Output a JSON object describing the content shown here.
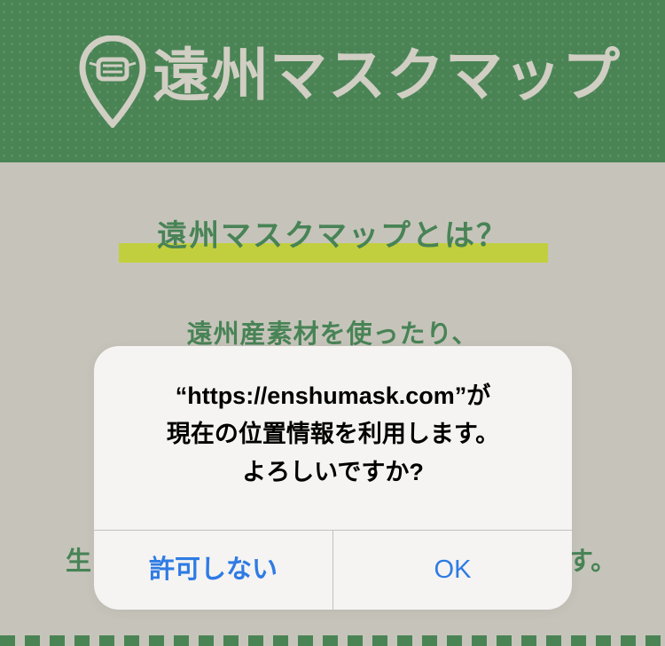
{
  "site": {
    "logo_text": "遠州マスクマップ",
    "logo_icon": "map-pin-mask-icon"
  },
  "about": {
    "title": "遠州マスクマップとは？",
    "line1": "遠州産素材を使ったり、",
    "fragment_left": "生",
    "fragment_right": "す。"
  },
  "alert": {
    "line1": "“https://enshumask.com”が",
    "line2": "現在の位置情報を利用します。",
    "line3": "よろしいですか?",
    "deny_label": "許可しない",
    "ok_label": "OK"
  },
  "colors": {
    "header_green": "#4c8757",
    "background": "#cac8bd",
    "text_green": "#4a8658",
    "highlight": "#c5d33f",
    "alert_button": "#2f7be4"
  }
}
